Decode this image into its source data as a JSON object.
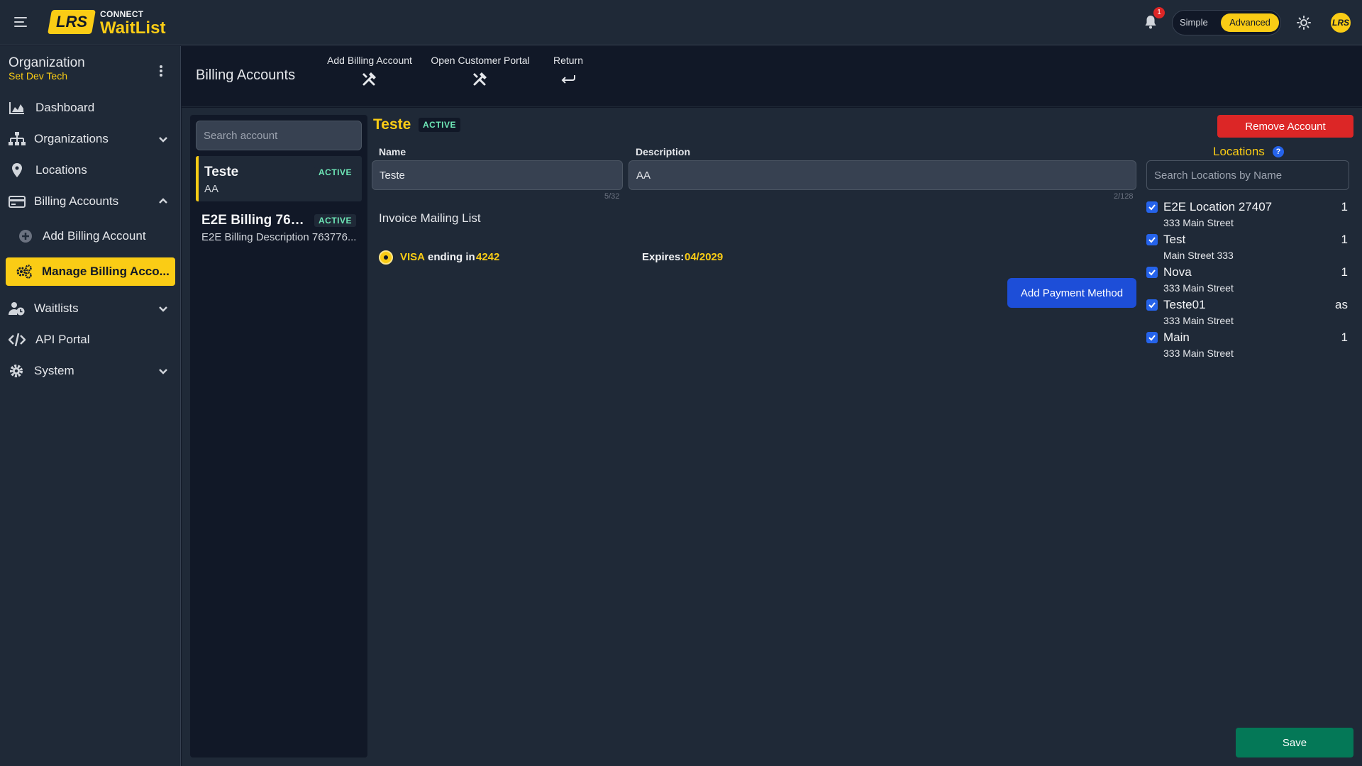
{
  "topbar": {
    "brand_small": "CONNECT",
    "brand_big": "WaitList",
    "logo_text": "LRS",
    "notification_count": "1",
    "mode_simple": "Simple",
    "mode_advanced": "Advanced",
    "avatar_text": "LRS"
  },
  "sidebar": {
    "org_title": "Organization",
    "org_subtitle": "Set Dev Tech",
    "items": [
      {
        "label": "Dashboard",
        "icon": "chart-area-icon"
      },
      {
        "label": "Organizations",
        "icon": "sitemap-icon"
      },
      {
        "label": "Locations",
        "icon": "map-pin-icon"
      },
      {
        "label": "Billing Accounts",
        "icon": "credit-card-icon"
      },
      {
        "label": "Add Billing Account",
        "icon": "plus-circle-icon"
      },
      {
        "label": "Manage Billing Acco...",
        "icon": "gears-icon"
      },
      {
        "label": "Waitlists",
        "icon": "user-clock-icon"
      },
      {
        "label": "API Portal",
        "icon": "code-icon"
      },
      {
        "label": "System",
        "icon": "cog-icon"
      }
    ]
  },
  "header": {
    "title": "Billing Accounts",
    "actions": [
      {
        "label": "Add Billing Account",
        "icon": "tools-icon"
      },
      {
        "label": "Open Customer Portal",
        "icon": "tools-icon"
      },
      {
        "label": "Return",
        "icon": "return-arrow-icon"
      }
    ]
  },
  "accounts": {
    "search_placeholder": "Search account",
    "list": [
      {
        "name": "Teste",
        "description": "AA",
        "status": "ACTIVE"
      },
      {
        "name": "E2E Billing 763...",
        "description": "E2E Billing Description 763776...",
        "status": "ACTIVE"
      }
    ]
  },
  "detail": {
    "title": "Teste",
    "status": "ACTIVE",
    "name_label": "Name",
    "name_value": "Teste",
    "name_count": "5/32",
    "description_label": "Description",
    "description_value": "AA",
    "description_count": "2/128",
    "invoice_label": "Invoice Mailing List",
    "payment": {
      "brand": "VISA",
      "ending_text": "ending in",
      "last4": "4242",
      "expires_label": "Expires:",
      "expires_value": "04/2029"
    },
    "add_payment_label": "Add Payment Method",
    "remove_label": "Remove Account",
    "save_label": "Save"
  },
  "locations": {
    "title": "Locations",
    "help": "?",
    "search_placeholder": "Search Locations by Name",
    "items": [
      {
        "name": "E2E Location 27407",
        "address": "333 Main Street",
        "value": "1"
      },
      {
        "name": "Test",
        "address": "Main Street 333",
        "value": "1"
      },
      {
        "name": "Nova",
        "address": "333 Main Street",
        "value": "1"
      },
      {
        "name": "Teste01",
        "address": "333 Main Street",
        "value": "as"
      },
      {
        "name": "Main",
        "address": "333 Main Street",
        "value": "1"
      }
    ]
  },
  "colors": {
    "accent": "#facc15",
    "background": "#111827",
    "panel": "#1f2937",
    "primary_blue": "#1d4ed8",
    "danger": "#dc2626",
    "success": "#047857"
  }
}
